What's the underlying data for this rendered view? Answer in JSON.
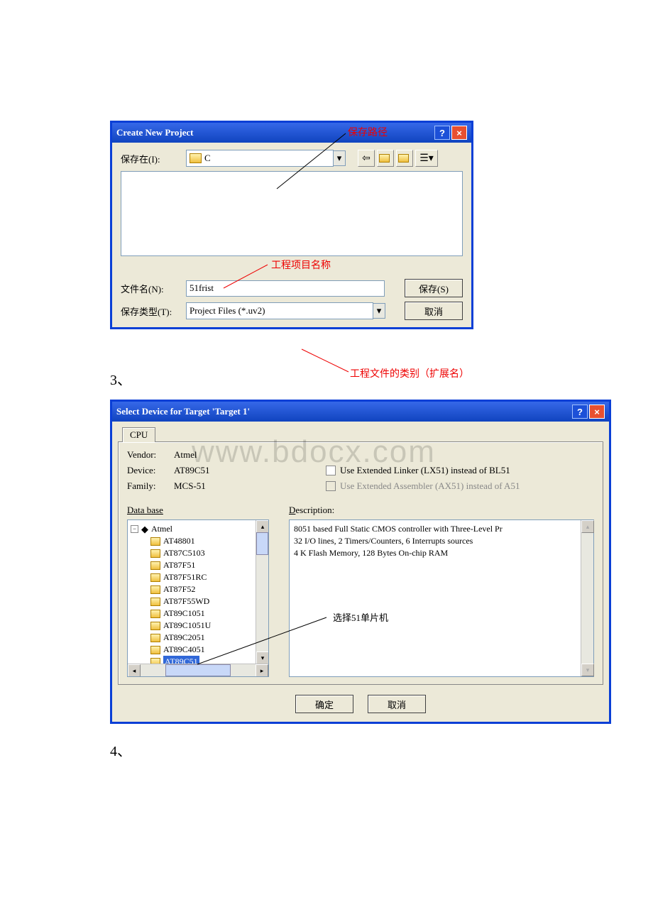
{
  "annotations": {
    "save_path": "保存路径",
    "project_name": "工程项目名称",
    "file_type": "工程文件的类别（扩展名）",
    "select_mcu": "选择51单片机"
  },
  "listnum": {
    "n3": "3、",
    "n4": "4、"
  },
  "dlg1": {
    "title": "Create New Project",
    "save_in_label": "保存在(I):",
    "save_in_value": "C",
    "filename_label": "文件名(N):",
    "filename_value": "51frist",
    "filetype_label": "保存类型(T):",
    "filetype_value": "Project Files (*.uv2)",
    "save_btn": "保存(S)",
    "cancel_btn": "取消"
  },
  "dlg2": {
    "title": "Select Device for Target 'Target 1'",
    "tab": "CPU",
    "vendor_label": "Vendor:",
    "vendor_value": "Atmel",
    "device_label": "Device:",
    "device_value": "AT89C51",
    "family_label": "Family:",
    "family_value": "MCS-51",
    "opt_linker": "Use Extended Linker (LX51) instead of BL51",
    "opt_asm": "Use Extended Assembler (AX51) instead of A51",
    "database_label": "Data base",
    "description_label": "Description:",
    "root": "Atmel",
    "devices": [
      "AT48801",
      "AT87C5103",
      "AT87F51",
      "AT87F51RC",
      "AT87F52",
      "AT87F55WD",
      "AT89C1051",
      "AT89C1051U",
      "AT89C2051",
      "AT89C4051",
      "AT89C51"
    ],
    "desc_line1": "8051 based Full Static CMOS controller with Three-Level Pr",
    "desc_line2": "32  I/O lines, 2 Timers/Counters, 6 Interrupts sources",
    "desc_line3": "4 K Flash Memory,  128 Bytes On-chip RAM",
    "ok_btn": "确定",
    "cancel_btn": "取消"
  },
  "watermark": "www.bdocx.com"
}
